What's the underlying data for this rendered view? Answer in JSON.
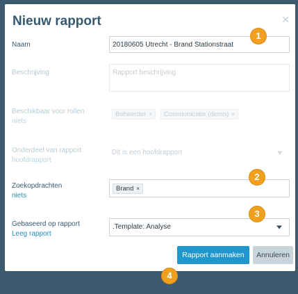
{
  "modal": {
    "title": "Nieuw rapport",
    "close_icon": "close-icon"
  },
  "fields": {
    "naam": {
      "label": "Naam",
      "value": "20180605 Utrecht - Brand Stationstraat"
    },
    "beschrijving": {
      "label": "Beschrijving",
      "placeholder": "Rapport beschrijving"
    },
    "rollen": {
      "label": "Beschikbaar voor rollen",
      "link": "niets",
      "tags": [
        "Beheerder",
        "Communicatie (demo)"
      ]
    },
    "onderdeel": {
      "label": "Onderdeel van rapport",
      "link": "hoofdrapport",
      "placeholder": "Dit is een hoofdrapport"
    },
    "zoekopdrachten": {
      "label": "Zoekopdrachten",
      "link": "niets",
      "tags": [
        "Brand"
      ]
    },
    "gebaseerd": {
      "label": "Gebaseerd op rapport",
      "link": "Leeg rapport",
      "value": ".Template: Analyse"
    }
  },
  "buttons": {
    "create": "Rapport aanmaken",
    "cancel": "Annuleren"
  },
  "badges": [
    "1",
    "2",
    "3",
    "4"
  ],
  "colors": {
    "accent": "#1f97cc",
    "badge": "#f0a020",
    "title": "#355a70",
    "backdrop": "#3d5a6e"
  }
}
